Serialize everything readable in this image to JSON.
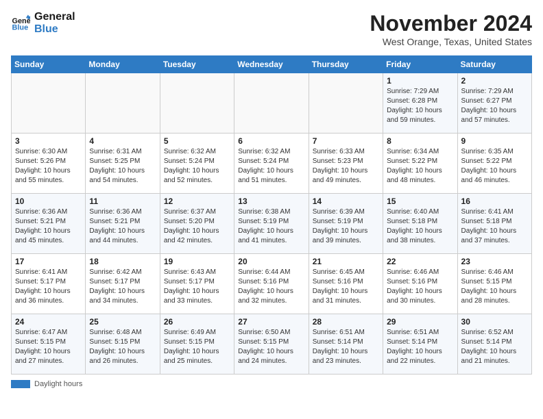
{
  "header": {
    "logo_line1": "General",
    "logo_line2": "Blue",
    "month": "November 2024",
    "location": "West Orange, Texas, United States"
  },
  "weekdays": [
    "Sunday",
    "Monday",
    "Tuesday",
    "Wednesday",
    "Thursday",
    "Friday",
    "Saturday"
  ],
  "weeks": [
    [
      {
        "day": "",
        "info": ""
      },
      {
        "day": "",
        "info": ""
      },
      {
        "day": "",
        "info": ""
      },
      {
        "day": "",
        "info": ""
      },
      {
        "day": "",
        "info": ""
      },
      {
        "day": "1",
        "info": "Sunrise: 7:29 AM\nSunset: 6:28 PM\nDaylight: 10 hours and 59 minutes."
      },
      {
        "day": "2",
        "info": "Sunrise: 7:29 AM\nSunset: 6:27 PM\nDaylight: 10 hours and 57 minutes."
      }
    ],
    [
      {
        "day": "3",
        "info": "Sunrise: 6:30 AM\nSunset: 5:26 PM\nDaylight: 10 hours and 55 minutes."
      },
      {
        "day": "4",
        "info": "Sunrise: 6:31 AM\nSunset: 5:25 PM\nDaylight: 10 hours and 54 minutes."
      },
      {
        "day": "5",
        "info": "Sunrise: 6:32 AM\nSunset: 5:24 PM\nDaylight: 10 hours and 52 minutes."
      },
      {
        "day": "6",
        "info": "Sunrise: 6:32 AM\nSunset: 5:24 PM\nDaylight: 10 hours and 51 minutes."
      },
      {
        "day": "7",
        "info": "Sunrise: 6:33 AM\nSunset: 5:23 PM\nDaylight: 10 hours and 49 minutes."
      },
      {
        "day": "8",
        "info": "Sunrise: 6:34 AM\nSunset: 5:22 PM\nDaylight: 10 hours and 48 minutes."
      },
      {
        "day": "9",
        "info": "Sunrise: 6:35 AM\nSunset: 5:22 PM\nDaylight: 10 hours and 46 minutes."
      }
    ],
    [
      {
        "day": "10",
        "info": "Sunrise: 6:36 AM\nSunset: 5:21 PM\nDaylight: 10 hours and 45 minutes."
      },
      {
        "day": "11",
        "info": "Sunrise: 6:36 AM\nSunset: 5:21 PM\nDaylight: 10 hours and 44 minutes."
      },
      {
        "day": "12",
        "info": "Sunrise: 6:37 AM\nSunset: 5:20 PM\nDaylight: 10 hours and 42 minutes."
      },
      {
        "day": "13",
        "info": "Sunrise: 6:38 AM\nSunset: 5:19 PM\nDaylight: 10 hours and 41 minutes."
      },
      {
        "day": "14",
        "info": "Sunrise: 6:39 AM\nSunset: 5:19 PM\nDaylight: 10 hours and 39 minutes."
      },
      {
        "day": "15",
        "info": "Sunrise: 6:40 AM\nSunset: 5:18 PM\nDaylight: 10 hours and 38 minutes."
      },
      {
        "day": "16",
        "info": "Sunrise: 6:41 AM\nSunset: 5:18 PM\nDaylight: 10 hours and 37 minutes."
      }
    ],
    [
      {
        "day": "17",
        "info": "Sunrise: 6:41 AM\nSunset: 5:17 PM\nDaylight: 10 hours and 36 minutes."
      },
      {
        "day": "18",
        "info": "Sunrise: 6:42 AM\nSunset: 5:17 PM\nDaylight: 10 hours and 34 minutes."
      },
      {
        "day": "19",
        "info": "Sunrise: 6:43 AM\nSunset: 5:17 PM\nDaylight: 10 hours and 33 minutes."
      },
      {
        "day": "20",
        "info": "Sunrise: 6:44 AM\nSunset: 5:16 PM\nDaylight: 10 hours and 32 minutes."
      },
      {
        "day": "21",
        "info": "Sunrise: 6:45 AM\nSunset: 5:16 PM\nDaylight: 10 hours and 31 minutes."
      },
      {
        "day": "22",
        "info": "Sunrise: 6:46 AM\nSunset: 5:16 PM\nDaylight: 10 hours and 30 minutes."
      },
      {
        "day": "23",
        "info": "Sunrise: 6:46 AM\nSunset: 5:15 PM\nDaylight: 10 hours and 28 minutes."
      }
    ],
    [
      {
        "day": "24",
        "info": "Sunrise: 6:47 AM\nSunset: 5:15 PM\nDaylight: 10 hours and 27 minutes."
      },
      {
        "day": "25",
        "info": "Sunrise: 6:48 AM\nSunset: 5:15 PM\nDaylight: 10 hours and 26 minutes."
      },
      {
        "day": "26",
        "info": "Sunrise: 6:49 AM\nSunset: 5:15 PM\nDaylight: 10 hours and 25 minutes."
      },
      {
        "day": "27",
        "info": "Sunrise: 6:50 AM\nSunset: 5:15 PM\nDaylight: 10 hours and 24 minutes."
      },
      {
        "day": "28",
        "info": "Sunrise: 6:51 AM\nSunset: 5:14 PM\nDaylight: 10 hours and 23 minutes."
      },
      {
        "day": "29",
        "info": "Sunrise: 6:51 AM\nSunset: 5:14 PM\nDaylight: 10 hours and 22 minutes."
      },
      {
        "day": "30",
        "info": "Sunrise: 6:52 AM\nSunset: 5:14 PM\nDaylight: 10 hours and 21 minutes."
      }
    ]
  ],
  "legend": {
    "color_label": "Daylight hours"
  }
}
